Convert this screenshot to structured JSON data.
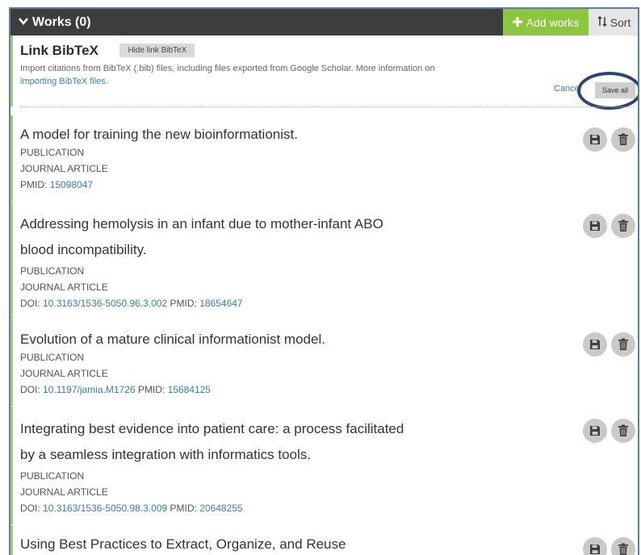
{
  "header": {
    "title": "Works (0)",
    "add_label": "Add works",
    "sort_label": "Sort"
  },
  "bibtex": {
    "title": "Link BibTeX",
    "hide_label": "Hide link BibTeX",
    "desc_text": "Import citations from BibTeX (.bib) files, including files exported from Google Scholar. More information on ",
    "desc_link": "importing BibTeX files.",
    "cancel_label": "Cancel",
    "save_all_label": "Save all"
  },
  "works": [
    {
      "title_line1": "A model for training the new bioinformationist.",
      "title_line2": "",
      "category": "PUBLICATION",
      "type": "JOURNAL ARTICLE",
      "doi": "",
      "pmid": "15098047"
    },
    {
      "title_line1": "Addressing hemolysis in an infant due to mother-infant ABO",
      "title_line2": "blood incompatibility.",
      "category": "PUBLICATION",
      "type": "JOURNAL ARTICLE",
      "doi": "10.3163/1536-5050.96.3.002",
      "pmid": "18654647"
    },
    {
      "title_line1": "Evolution of a mature clinical informationist model.",
      "title_line2": "",
      "category": "PUBLICATION",
      "type": "JOURNAL ARTICLE",
      "doi": "10.1197/jamia.M1726",
      "pmid": "15684125"
    },
    {
      "title_line1": "Integrating best evidence into patient care: a process facilitated",
      "title_line2": "by a seamless integration with informatics tools.",
      "category": "PUBLICATION",
      "type": "JOURNAL ARTICLE",
      "doi": "10.3163/1536-5050.98.3.009",
      "pmid": "20648255"
    },
    {
      "title_line1": "Using Best Practices to Extract, Organize, and Reuse",
      "title_line2": "",
      "category": "",
      "type": "",
      "doi": "",
      "pmid": ""
    }
  ],
  "labels": {
    "doi": "DOI:",
    "pmid": "PMID:"
  },
  "colors": {
    "header_bg": "#3d3d3d",
    "add_button": "#8cc63f",
    "link": "#3a7fa5",
    "accent_border": "#a5cf63",
    "annotation": "#2c4672"
  }
}
